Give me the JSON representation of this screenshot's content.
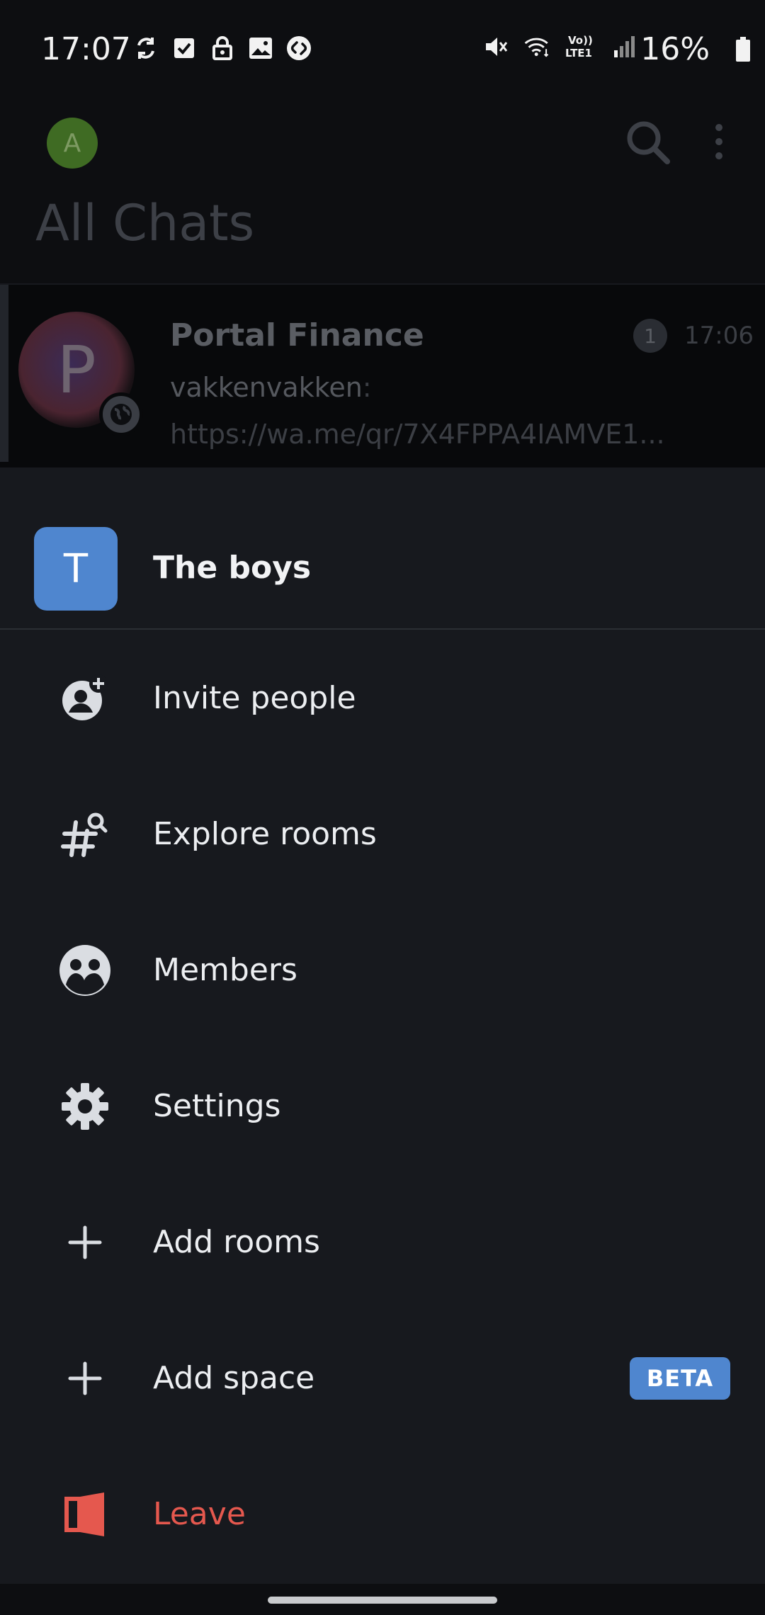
{
  "status_bar": {
    "time": "17:07",
    "battery": "16%",
    "icons": [
      "sync-icon",
      "check-box-icon",
      "lock-icon",
      "image-icon",
      "shazam-icon",
      "mute-icon",
      "wifi-icon",
      "volte-icon",
      "signal-icon",
      "battery-icon"
    ],
    "volte_label": "Vo)) LTE1"
  },
  "header": {
    "avatar_letter": "A",
    "title": "All Chats"
  },
  "chat": {
    "avatar_letter": "P",
    "name": "Portal Finance",
    "sender": "vakkenvakken",
    "preview": ": https://wa.me/qr/7X4FPPA4IAMVE1...",
    "unread": "1",
    "time": "17:06"
  },
  "sheet": {
    "space_letter": "T",
    "space_name": "The boys",
    "items": [
      {
        "label": "Invite people",
        "icon": "invite-people-icon"
      },
      {
        "label": "Explore rooms",
        "icon": "explore-rooms-icon"
      },
      {
        "label": "Members",
        "icon": "members-icon"
      },
      {
        "label": "Settings",
        "icon": "gear-icon"
      },
      {
        "label": "Add rooms",
        "icon": "plus-icon"
      },
      {
        "label": "Add space",
        "icon": "plus-icon",
        "badge": "BETA"
      },
      {
        "label": "Leave",
        "icon": "leave-icon"
      }
    ]
  },
  "colors": {
    "accent": "#4f86cf",
    "danger": "#e5584e",
    "background": "#17191e"
  }
}
